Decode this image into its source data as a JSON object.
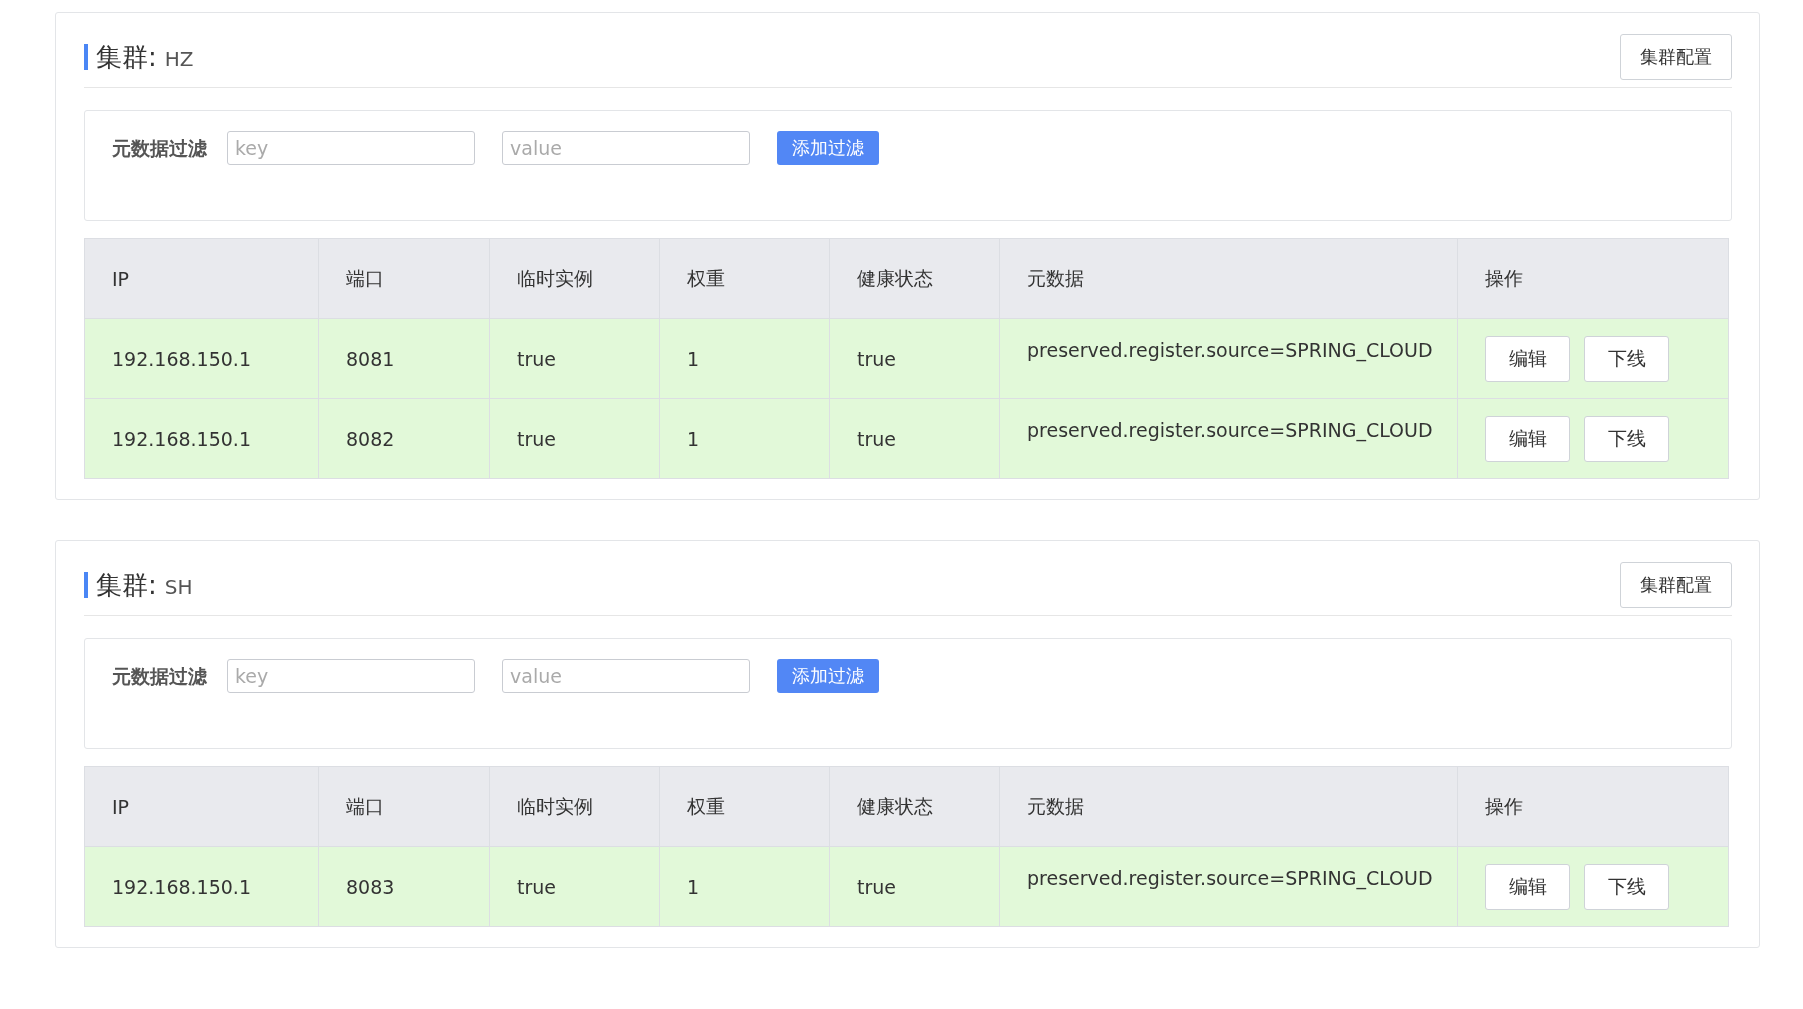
{
  "clusters": [
    {
      "title_label": "集群:",
      "name": "HZ",
      "config_button": "集群配置",
      "filter": {
        "label": "元数据过滤",
        "key_placeholder": "key",
        "value_placeholder": "value",
        "add_button": "添加过滤"
      },
      "table": {
        "columns": [
          "IP",
          "端口",
          "临时实例",
          "权重",
          "健康状态",
          "元数据",
          "操作"
        ],
        "rows": [
          {
            "cells": [
              "192.168.150.1",
              "8081",
              "true",
              "1",
              "true",
              "preserved.register.source=SPRING_CLOUD"
            ],
            "actions": [
              "编辑",
              "下线"
            ]
          },
          {
            "cells": [
              "192.168.150.1",
              "8082",
              "true",
              "1",
              "true",
              "preserved.register.source=SPRING_CLOUD"
            ],
            "actions": [
              "编辑",
              "下线"
            ]
          }
        ]
      }
    },
    {
      "title_label": "集群:",
      "name": "SH",
      "config_button": "集群配置",
      "filter": {
        "label": "元数据过滤",
        "key_placeholder": "key",
        "value_placeholder": "value",
        "add_button": "添加过滤"
      },
      "table": {
        "columns": [
          "IP",
          "端口",
          "临时实例",
          "权重",
          "健康状态",
          "元数据",
          "操作"
        ],
        "rows": [
          {
            "cells": [
              "192.168.150.1",
              "8083",
              "true",
              "1",
              "true",
              "preserved.register.source=SPRING_CLOUD"
            ],
            "actions": [
              "编辑",
              "下线"
            ]
          }
        ]
      }
    }
  ]
}
